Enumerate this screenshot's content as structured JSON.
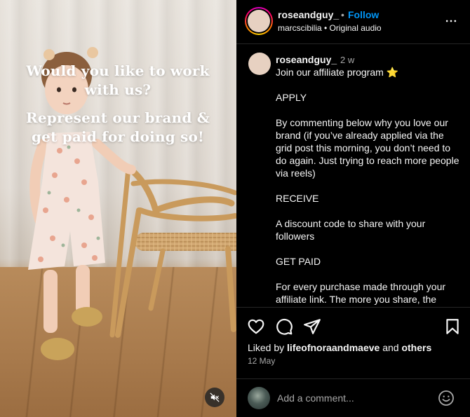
{
  "media": {
    "overlay_line1": "Would you like to work with us?",
    "overlay_line2": "Represent our brand & get paid for doing so!",
    "mute_icon": "speaker-muted-icon"
  },
  "header": {
    "username": "roseandguy_",
    "separator": "•",
    "follow_label": "Follow",
    "subline": "marcscibilia • Original audio",
    "more_icon": "more-horizontal-icon"
  },
  "caption": {
    "username": "roseandguy_",
    "time": "2 w",
    "paragraphs": [
      "Join our affiliate program",
      "APPLY",
      "By commenting below why you love our brand (if you’ve already applied via the grid post this morning, you don’t need to do again. Just trying to reach more people via reels)",
      "RECEIVE",
      "A discount code to share with your followers",
      "GET PAID",
      "For every purchase made through your affiliate link. The more you share, the more you earn."
    ],
    "star_emoji": "⭐"
  },
  "actions": {
    "icons": [
      "heart-icon",
      "comment-icon",
      "share-icon",
      "bookmark-icon"
    ]
  },
  "likes": {
    "prefix": "Liked by",
    "user": "lifeofnoraandmaeve",
    "and": "and",
    "others": "others"
  },
  "date": "12 May",
  "comment": {
    "placeholder": "Add a comment...",
    "emoji_icon": "emoji-smile-icon"
  },
  "colors": {
    "background": "#000000",
    "accent": "#0095f6",
    "secondary_text": "#a8a8a8",
    "divider": "#262626"
  }
}
